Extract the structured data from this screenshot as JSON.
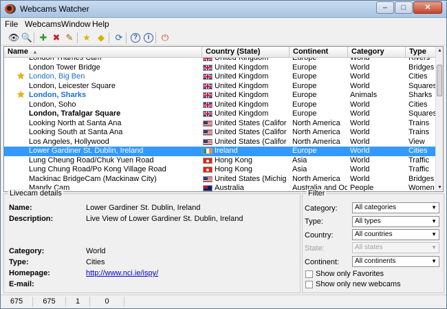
{
  "window": {
    "title": "Webcams Watcher",
    "minimize": "–",
    "maximize": "□",
    "close": "✕"
  },
  "menu": [
    "File",
    "Webcams",
    "Window",
    "Help"
  ],
  "toolbar": [
    {
      "name": "eye-icon",
      "glyph": "👁",
      "color": "#223"
    },
    {
      "name": "search-icon",
      "glyph": "🔍",
      "color": "#223"
    },
    {
      "name": "add-webcam-icon",
      "glyph": "✚",
      "color": "#2a9a2a"
    },
    {
      "name": "delete-webcam-icon",
      "glyph": "✖",
      "color": "#c0202a"
    },
    {
      "name": "edit-webcam-icon",
      "glyph": "✎",
      "color": "#a0601a"
    },
    {
      "name": "favorite-star-icon",
      "glyph": "★",
      "color": "#e2b100"
    },
    {
      "name": "new-webcam-diamond-icon",
      "glyph": "◆",
      "color": "#d8b000"
    },
    {
      "name": "refresh-icon",
      "glyph": "⟳",
      "color": "#2a66b8"
    },
    {
      "name": "help-icon",
      "glyph": "?",
      "color": "#2e5bb8"
    },
    {
      "name": "info-icon",
      "glyph": "i",
      "color": "#2e5bb8"
    },
    {
      "name": "exit-icon",
      "glyph": "⏻",
      "color": "#d8462a"
    }
  ],
  "columns": {
    "name": "Name",
    "country": "Country (State)",
    "continent": "Continent",
    "category": "Category",
    "type": "Type",
    "sort_glyph": "▲"
  },
  "rows": [
    {
      "name": "London Thames Cam",
      "country": "United Kingdom",
      "flag": "uk",
      "continent": "Europe",
      "category": "World",
      "type": "Rivers",
      "fav": false,
      "isnew": false,
      "sel": false
    },
    {
      "name": "London Tower Bridge",
      "country": "United Kingdom",
      "flag": "uk",
      "continent": "Europe",
      "category": "World",
      "type": "Bridges",
      "fav": false,
      "isnew": false,
      "sel": false
    },
    {
      "name": "London, Big Ben",
      "country": "United Kingdom",
      "flag": "uk",
      "continent": "Europe",
      "category": "World",
      "type": "Cities",
      "fav": true,
      "isnew": false,
      "sel": false
    },
    {
      "name": "London, Leicester Square",
      "country": "United Kingdom",
      "flag": "uk",
      "continent": "Europe",
      "category": "World",
      "type": "Squares",
      "fav": false,
      "isnew": false,
      "sel": false
    },
    {
      "name": "London, Sharks",
      "country": "United Kingdom",
      "flag": "uk",
      "continent": "Europe",
      "category": "Animals",
      "type": "Sharks",
      "fav": true,
      "isnew": true,
      "sel": false
    },
    {
      "name": "London, Soho",
      "country": "United Kingdom",
      "flag": "uk",
      "continent": "Europe",
      "category": "World",
      "type": "Cities",
      "fav": false,
      "isnew": false,
      "sel": false
    },
    {
      "name": "London, Trafalgar Square",
      "country": "United Kingdom",
      "flag": "uk",
      "continent": "Europe",
      "category": "World",
      "type": "Squares",
      "fav": false,
      "isnew": true,
      "sel": false
    },
    {
      "name": "Looking North at Santa Ana",
      "country": "United States (California)",
      "flag": "us",
      "continent": "North America",
      "category": "World",
      "type": "Trains",
      "fav": false,
      "isnew": false,
      "sel": false
    },
    {
      "name": "Looking South at Santa Ana",
      "country": "United States (California)",
      "flag": "us",
      "continent": "North America",
      "category": "World",
      "type": "Trains",
      "fav": false,
      "isnew": false,
      "sel": false
    },
    {
      "name": "Los Angeles, Hollywood",
      "country": "United States (California)",
      "flag": "us",
      "continent": "North America",
      "category": "World",
      "type": "View",
      "fav": false,
      "isnew": false,
      "sel": false
    },
    {
      "name": "Lower Gardiner St. Dublin, Ireland",
      "country": "Ireland",
      "flag": "ie",
      "continent": "Europe",
      "category": "World",
      "type": "Cities",
      "fav": false,
      "isnew": false,
      "sel": true
    },
    {
      "name": "Lung Cheung Road/Chuk Yuen Road",
      "country": "Hong Kong",
      "flag": "hk",
      "continent": "Asia",
      "category": "World",
      "type": "Traffic",
      "fav": false,
      "isnew": false,
      "sel": false
    },
    {
      "name": "Lung Chung Road/Po Kong Village Road",
      "country": "Hong Kong",
      "flag": "hk",
      "continent": "Asia",
      "category": "World",
      "type": "Traffic",
      "fav": false,
      "isnew": false,
      "sel": false
    },
    {
      "name": "Mackinac BridgeCam (Mackinaw City)",
      "country": "United States (Michigan)",
      "flag": "us",
      "continent": "North America",
      "category": "World",
      "type": "Bridges",
      "fav": false,
      "isnew": false,
      "sel": false
    },
    {
      "name": "Mandy Cam",
      "country": "Australia",
      "flag": "au",
      "continent": "Australia and Oc...",
      "category": "People",
      "type": "Women",
      "fav": false,
      "isnew": false,
      "sel": false
    }
  ],
  "details": {
    "title": "Livecam details",
    "name_label": "Name:",
    "name_value": "Lower Gardiner St. Dublin, Ireland",
    "description_label": "Description:",
    "description_value": "Live View of Lower Gardiner St. Dublin, Ireland",
    "category_label": "Category:",
    "category_value": "World",
    "type_label": "Type:",
    "type_value": "Cities",
    "homepage_label": "Homepage:",
    "homepage_value": "http://www.nci.ie/ispy/",
    "email_label": "E-mail:"
  },
  "filter": {
    "title": "Filter",
    "category_label": "Category:",
    "category_value": "All categories",
    "type_label": "Type:",
    "type_value": "All types",
    "country_label": "Country:",
    "country_value": "All countries",
    "state_label": "State:",
    "state_value": "All states",
    "continent_label": "Continent:",
    "continent_value": "All continents",
    "favorites_label": "Show only Favorites",
    "new_label": "Show only new webcams",
    "caret": "▼"
  },
  "status": [
    "675",
    "675",
    "1",
    "0"
  ],
  "scroll": {
    "up": "▲",
    "down": "▼"
  }
}
